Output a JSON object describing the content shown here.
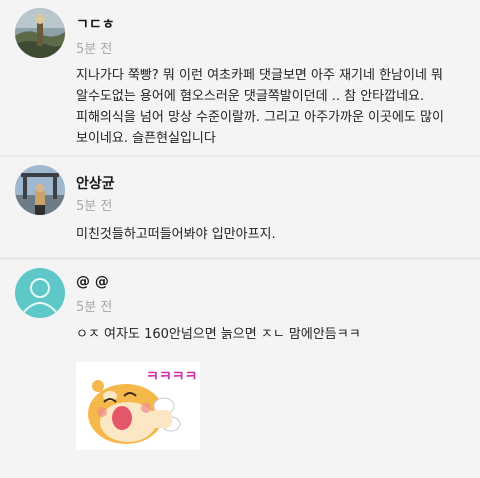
{
  "comments": [
    {
      "author": "ㄱㄷㅎ",
      "time": "5분 전",
      "text": "지나가다 쭉빵? 뭐 이런 여초카페 댓글보면 아주 재기네 한남이네 뭐\n알수도없는 용어에 혐오스러운 댓글쪽발이던데 .. 참 안타깝네요.\n피해의식을 넘어 망상 수준이랄까. 그리고 아주가까운 이곳에도 많이\n보이네요. 슬픈현실입니다",
      "avatar_icon": "landscape-avatar"
    },
    {
      "author": "안상균",
      "time": "5분 전",
      "text": "미친것들하고떠들어봐야 입만아프지.",
      "avatar_icon": "landmark-avatar"
    },
    {
      "author": "@ @",
      "time": "5분 전",
      "text": "ㅇㅈ 여자도 160안넘으면 늙으면 ㅈㄴ 맘에안듬ㅋㅋ",
      "avatar_icon": "default-person-avatar",
      "sticker_text": "ㅋㅋㅋㅋ"
    }
  ],
  "colors": {
    "background": "#ebebeb",
    "card": "#f4f4f4",
    "timestamp": "#a8a8a8",
    "default_avatar": "#5ec8c8"
  }
}
